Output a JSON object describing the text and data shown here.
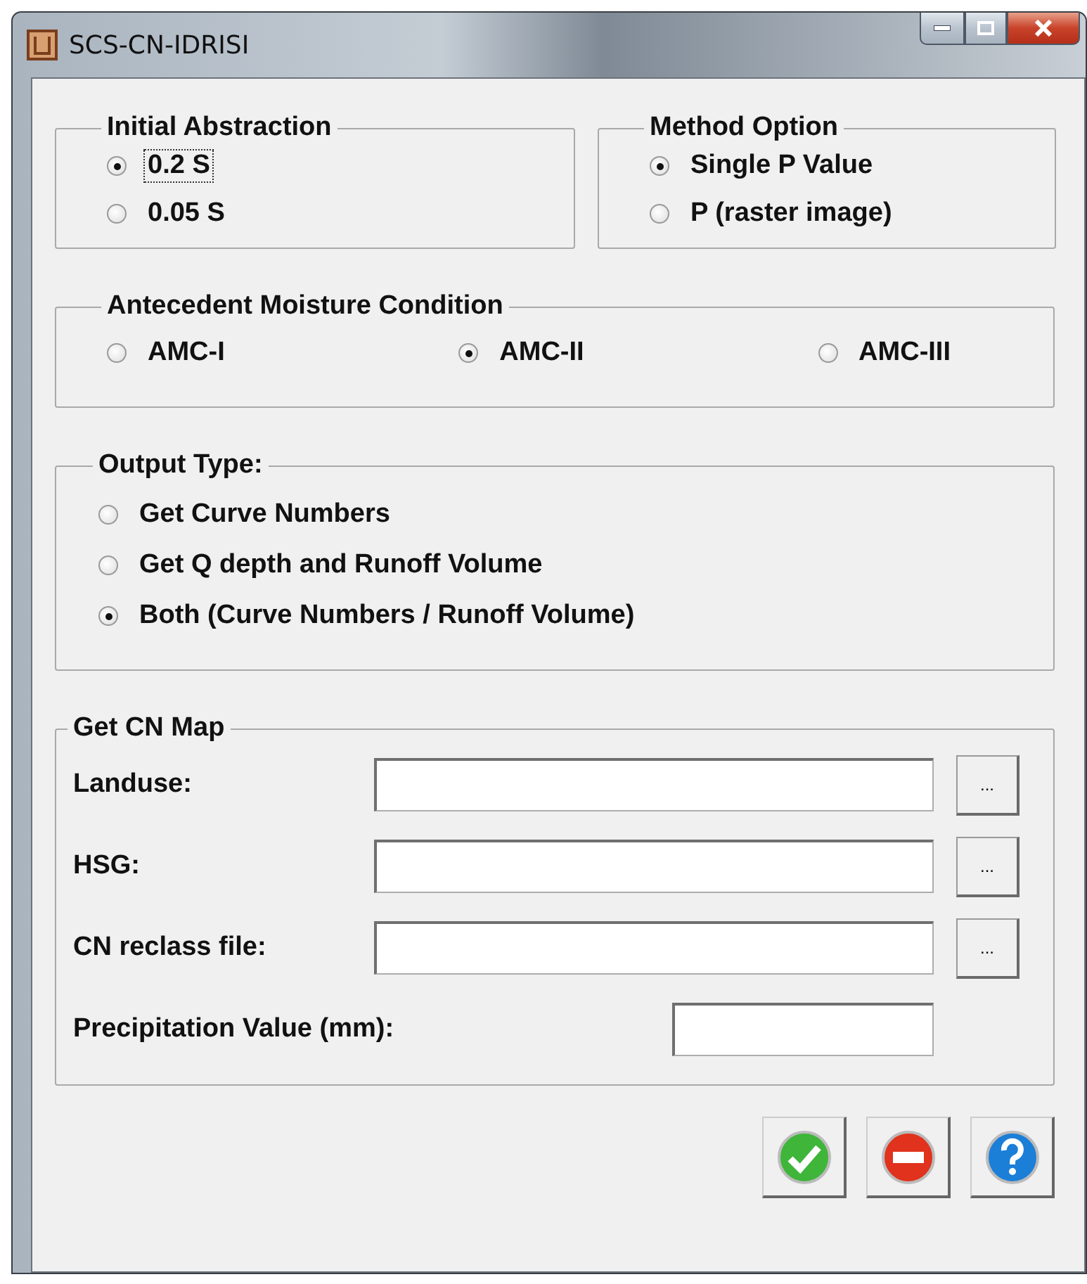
{
  "window": {
    "title": "SCS-CN-IDRISI"
  },
  "groups": [
    {
      "title": "Initial Abstraction",
      "options": [
        {
          "label": "0.2 S",
          "selected": true,
          "focused": true
        },
        {
          "label": "0.05 S",
          "selected": false,
          "focused": false
        }
      ]
    },
    {
      "title": "Method Option",
      "options": [
        {
          "label": "Single P Value",
          "selected": true,
          "focused": false
        },
        {
          "label": "P (raster image)",
          "selected": false,
          "focused": false
        }
      ]
    },
    {
      "title": "Antecedent Moisture Condition",
      "options": [
        {
          "label": "AMC-I",
          "selected": false,
          "focused": false
        },
        {
          "label": "AMC-II",
          "selected": true,
          "focused": false
        },
        {
          "label": "AMC-III",
          "selected": false,
          "focused": false
        }
      ]
    },
    {
      "title": "Output Type:",
      "options": [
        {
          "label": "Get Curve Numbers",
          "selected": false,
          "focused": false
        },
        {
          "label": "Get Q depth and Runoff Volume",
          "selected": false,
          "focused": false
        },
        {
          "label": "Both (Curve Numbers / Runoff Volume)",
          "selected": true,
          "focused": false
        }
      ]
    }
  ],
  "cn_map": {
    "title": "Get CN Map",
    "fields": [
      {
        "label": "Landuse:",
        "kind": "file",
        "browse": "..."
      },
      {
        "label": "HSG:",
        "kind": "file",
        "browse": "..."
      },
      {
        "label": "CN reclass file:",
        "kind": "file",
        "browse": "..."
      },
      {
        "label": "Precipitation Value (mm):",
        "kind": "value"
      }
    ]
  },
  "buttons": [
    {
      "kind": "ok"
    },
    {
      "kind": "cancel"
    },
    {
      "kind": "help"
    }
  ]
}
